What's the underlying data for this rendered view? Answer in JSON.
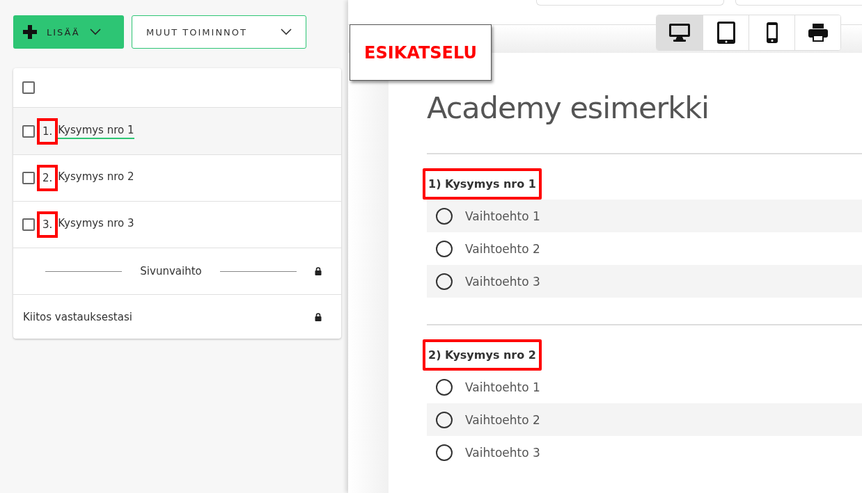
{
  "toolbar": {
    "add_button": "LISÄÄ",
    "more_button": "MUUT TOIMINNOT"
  },
  "list": {
    "select_all": {
      "checked": false
    },
    "questions": [
      {
        "number": "1.",
        "title": "Kysymys nro 1",
        "checked": false,
        "selected": true,
        "annotated": true
      },
      {
        "number": "2.",
        "title": "Kysymys nro 2",
        "checked": false,
        "selected": false,
        "annotated": true
      },
      {
        "number": "3.",
        "title": "Kysymys nro 3",
        "checked": false,
        "selected": false,
        "annotated": true
      }
    ],
    "page_break": {
      "label": "Sivunvaihto",
      "locked": true
    },
    "thanks": {
      "label": "Kiitos vastauksestasi",
      "locked": true
    }
  },
  "preview": {
    "badge": "ESIKATSELU",
    "devices": [
      {
        "kind": "desktop",
        "selected": true
      },
      {
        "kind": "tablet",
        "selected": false
      },
      {
        "kind": "phone",
        "selected": false
      },
      {
        "kind": "print",
        "selected": false
      }
    ],
    "title": "Academy esimerkki",
    "questions": [
      {
        "title": "1) Kysymys nro 1",
        "annotated": true,
        "options": [
          {
            "label": "Vaihtoehto 1",
            "selected": false
          },
          {
            "label": "Vaihtoehto 2",
            "selected": false
          },
          {
            "label": "Vaihtoehto 3",
            "selected": false
          }
        ]
      },
      {
        "title": "2) Kysymys nro 2",
        "annotated": true,
        "options": [
          {
            "label": "Vaihtoehto 1",
            "selected": false
          },
          {
            "label": "Vaihtoehto 2",
            "selected": false
          },
          {
            "label": "Vaihtoehto 3",
            "selected": false
          }
        ]
      }
    ]
  }
}
